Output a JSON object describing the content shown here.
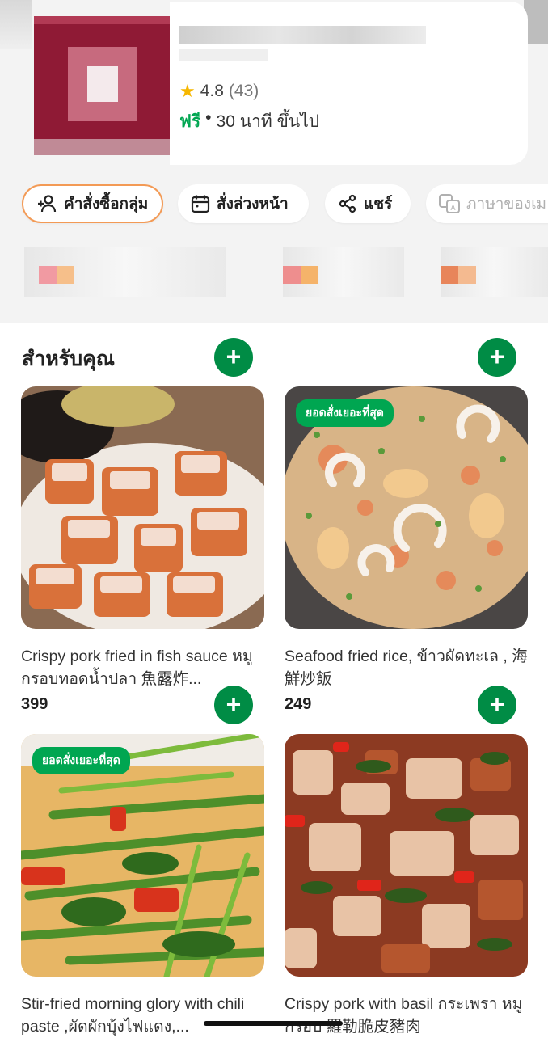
{
  "store": {
    "rating": "4.8",
    "rating_count": "(43)",
    "delivery_free": "ฟรี",
    "delivery_separator": "•",
    "delivery_time": "30 นาที ขึ้นไป"
  },
  "actions": [
    {
      "label": "คำสั่งซื้อกลุ่ม",
      "icon": "group-order-icon"
    },
    {
      "label": "สั่งล่วงหน้า",
      "icon": "calendar-icon"
    },
    {
      "label": "แชร์",
      "icon": "share-icon"
    },
    {
      "label": "ภาษาของเม",
      "icon": "translate-icon"
    }
  ],
  "section": {
    "title": "สำหรับคุณ"
  },
  "dishes": [
    {
      "name": "Crispy pork fried in fish sauce หมูกรอบทอดน้ำปลา 魚露炸...",
      "price": "399",
      "badge": ""
    },
    {
      "name": "Seafood fried rice, ข้าวผัดทะเล , 海鮮炒飯",
      "price": "249",
      "badge": "ยอดสั่งเยอะที่สุด"
    },
    {
      "name": "Stir-fried morning glory with chili paste ,ผัดผักบุ้งไฟแดง,...",
      "price": "",
      "badge": "ยอดสั่งเยอะที่สุด"
    },
    {
      "name": "Crispy pork with basil กระเพรา หมูกรอบ 羅勒脆皮豬肉",
      "price": "",
      "badge": ""
    }
  ],
  "add_button_symbol": "+",
  "colors": {
    "accent_green": "#00a651",
    "add_button": "#008c45",
    "star": "#f6b700",
    "group_chip_border": "#f39a55"
  }
}
